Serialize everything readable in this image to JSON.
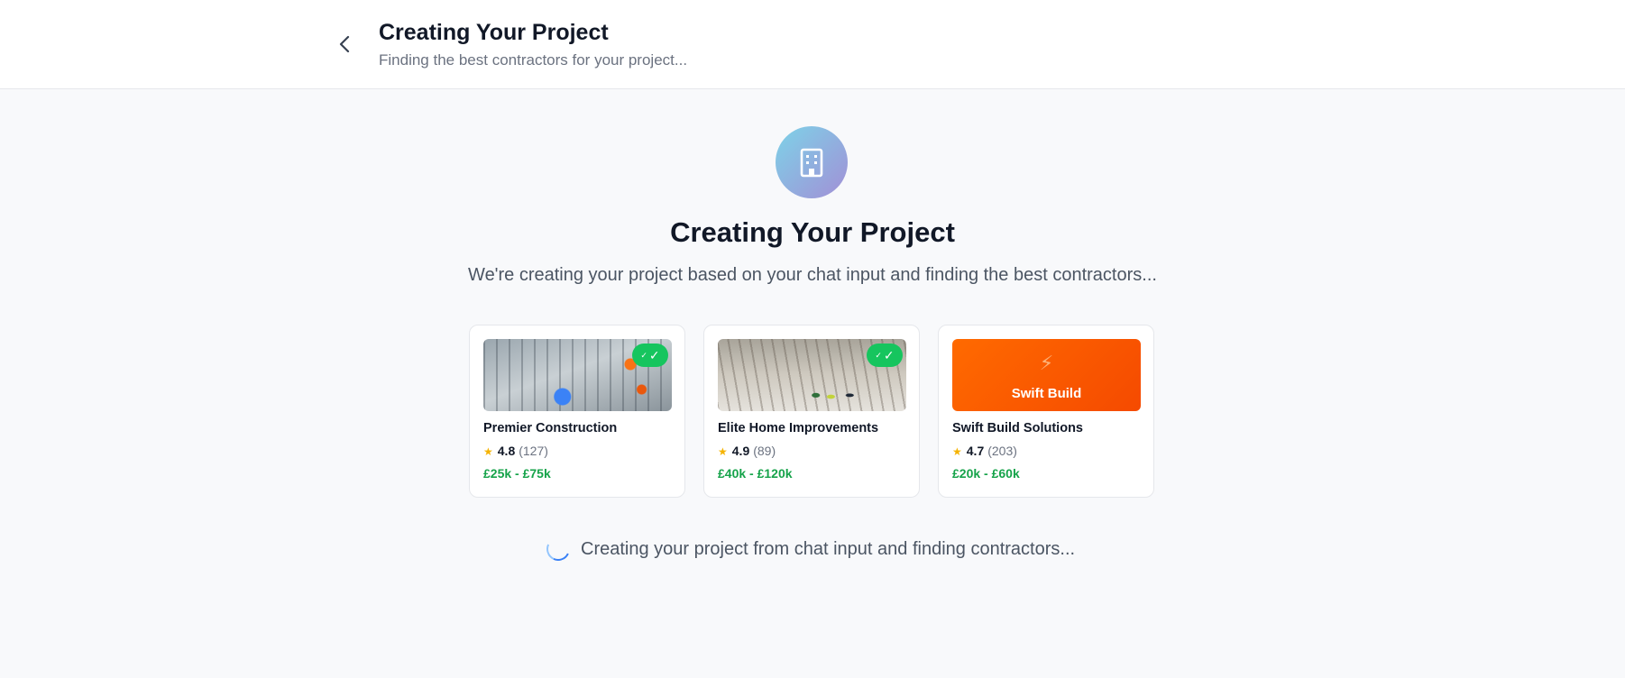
{
  "header": {
    "back_icon": "chevron-left-icon",
    "title": "Creating Your Project",
    "subtitle": "Finding the best contractors for your project..."
  },
  "hero": {
    "icon": "building-icon",
    "title": "Creating Your Project",
    "description": "We're creating your project based on your chat input and finding the best contractors..."
  },
  "contractors": [
    {
      "name": "Premier Construction",
      "rating": "4.8",
      "reviews": "(127)",
      "price": "£25k - £75k",
      "verified": true,
      "verified_mark_small": "✓",
      "verified_mark": "✓"
    },
    {
      "name": "Elite Home Improvements",
      "rating": "4.9",
      "reviews": "(89)",
      "price": "£40k - £120k",
      "verified": true,
      "verified_mark_small": "✓",
      "verified_mark": "✓"
    },
    {
      "name": "Swift Build Solutions",
      "rating": "4.7",
      "reviews": "(203)",
      "price": "£20k - £60k",
      "verified": false,
      "logo_icon": "lightning-icon",
      "logo_text": "Swift Build"
    }
  ],
  "star_glyph": "★",
  "status": {
    "icon": "spinner-icon",
    "text": "Creating your project from chat input and finding contractors..."
  },
  "colors": {
    "accent_green": "#16a34a",
    "badge_green": "#16c55e",
    "star": "#f5b301",
    "swift_orange": "#ff6a00"
  }
}
